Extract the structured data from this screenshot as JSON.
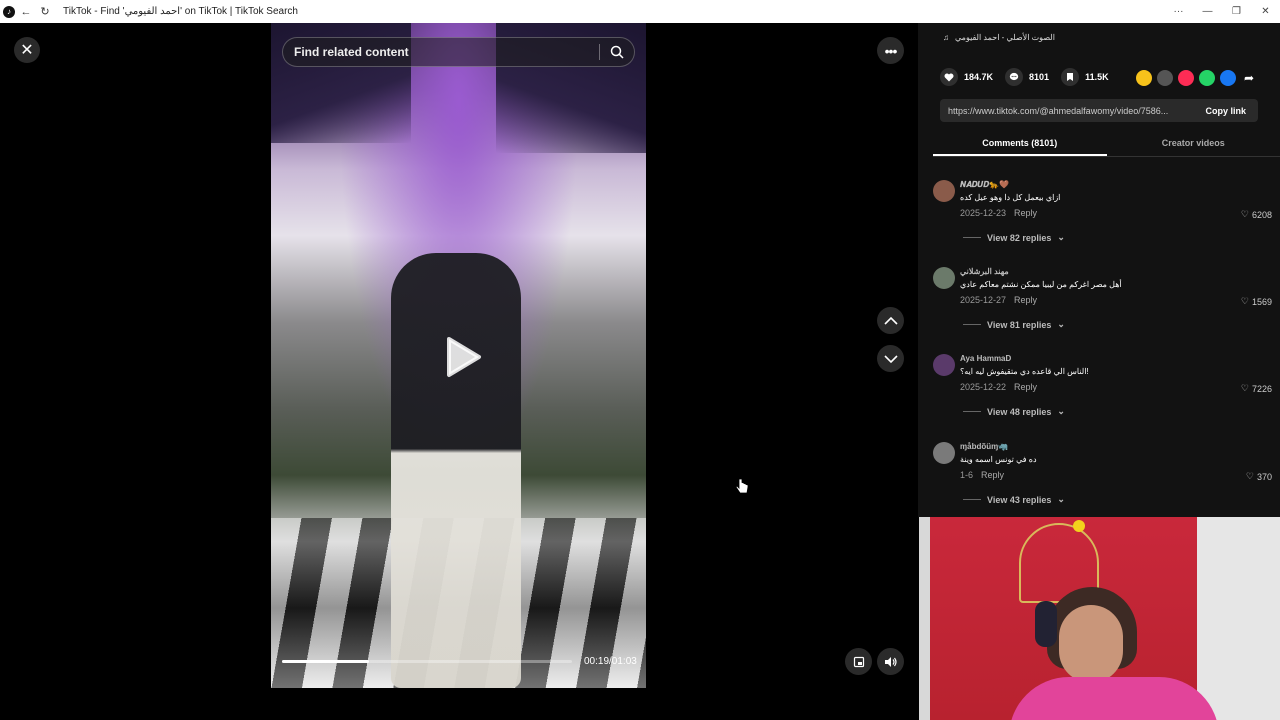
{
  "browser": {
    "title": "TikTok - Find 'احمد الفيومي' on TikTok | TikTok Search"
  },
  "player": {
    "search_placeholder": "Find related content",
    "time": "00:19/01:03",
    "progress": 0.3
  },
  "panel": {
    "music": "الصوت الأصلي - احمد الفيومي",
    "likes": "184.7K",
    "comments_count": "8101",
    "saves": "11.5K",
    "link": "https://www.tiktok.com/@ahmedalfawomy/video/7586...",
    "copy_label": "Copy link",
    "tabs": [
      "Comments (8101)",
      "Creator videos"
    ]
  },
  "comments": [
    {
      "name": "𝑵𝑨𝑫𝑼𝑫🐆🤎",
      "text": "ازاي بيعمل كل دا وهو عيل كده",
      "date": "2025-12-23",
      "reply": "Reply",
      "likes": "6208",
      "view": "View 82 replies"
    },
    {
      "name": "مهند البرشلاني",
      "text": "أهل مصر اغركم من ليبيا ممكن نشتم معاكم عادي",
      "date": "2025-12-27",
      "reply": "Reply",
      "likes": "1569",
      "view": "View 81 replies"
    },
    {
      "name": "Aya HammaD",
      "text": "الناس الي قاعده دي متقيفوش ليه ايه؟!",
      "date": "2025-12-22",
      "reply": "Reply",
      "likes": "7226",
      "view": "View 48 replies"
    },
    {
      "name": "ɱåbdõüɱ🦏",
      "text": "ده في تونس اسمه وينة",
      "date": "1-6",
      "reply": "Reply",
      "likes": "370",
      "view": "View 43 replies"
    }
  ],
  "colors": {
    "accent_share": [
      "#f7c21b",
      "#555555",
      "#fe2c55",
      "#25d366",
      "#1877f2",
      "#ffffff"
    ]
  }
}
